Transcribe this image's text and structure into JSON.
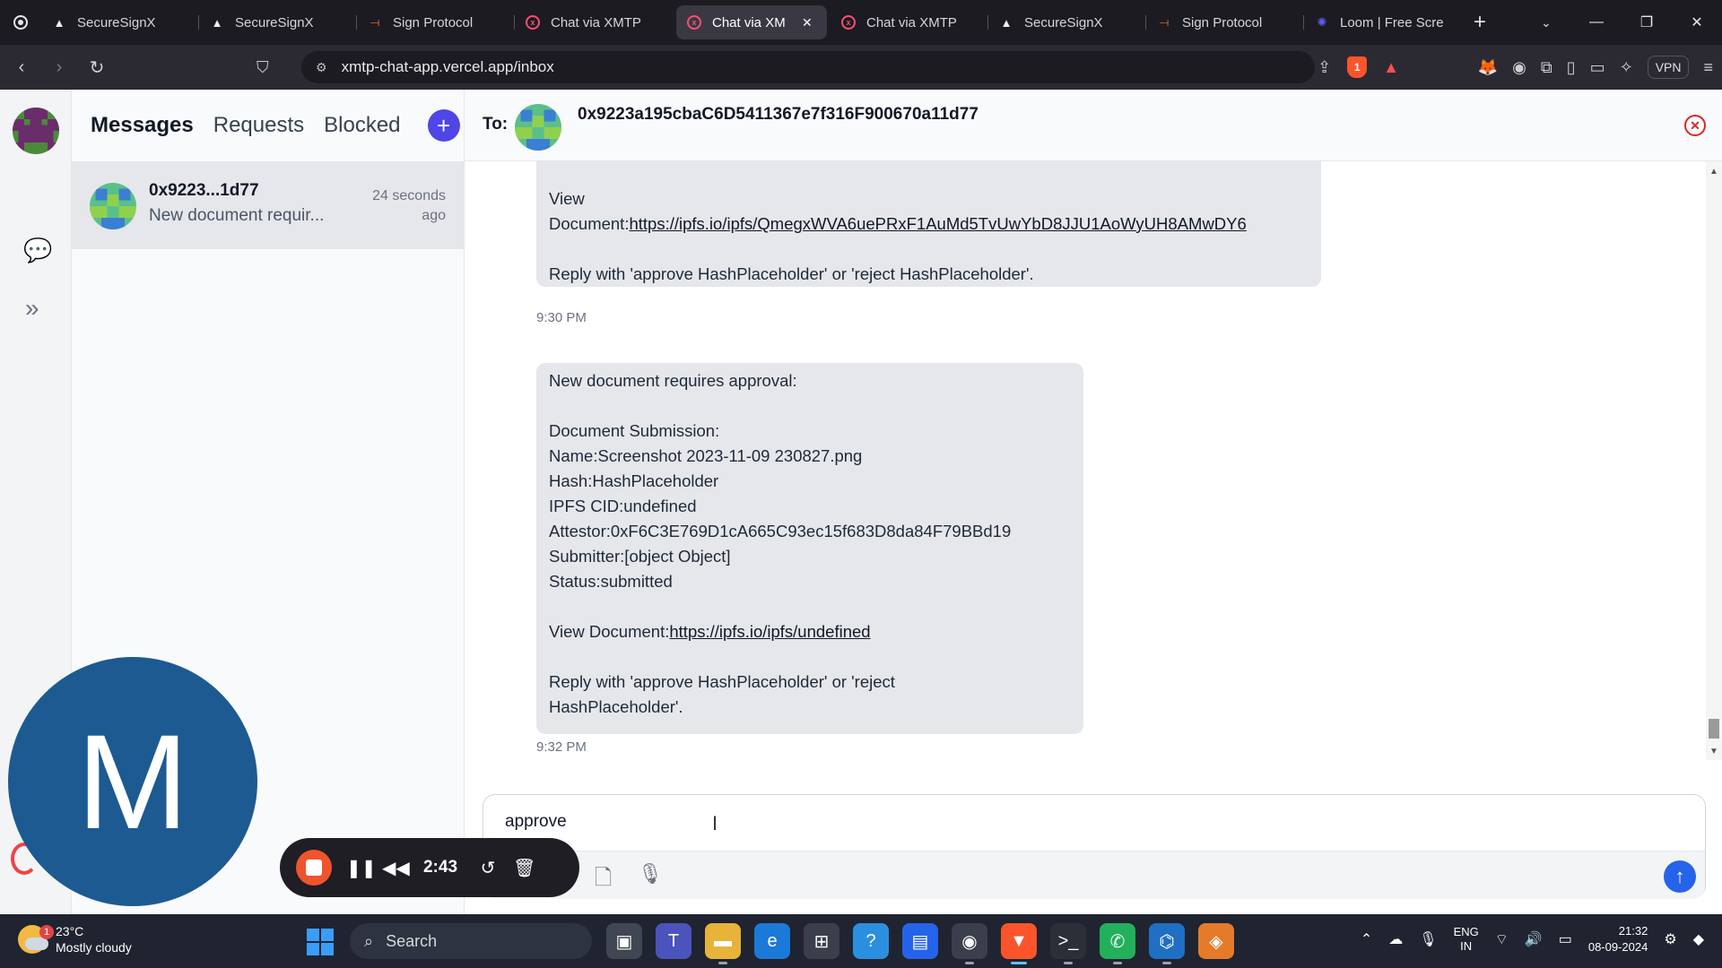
{
  "browser": {
    "tabs": [
      {
        "label": "SecureSignX",
        "icon": "triangle-icon"
      },
      {
        "label": "SecureSignX",
        "icon": "triangle-icon"
      },
      {
        "label": "Sign Protocol",
        "icon": "sign-protocol-icon"
      },
      {
        "label": "Chat via XMTP",
        "icon": "xmtp-icon"
      },
      {
        "label": "Chat via XM",
        "icon": "xmtp-icon",
        "active": true
      },
      {
        "label": "Chat via XMTP",
        "icon": "xmtp-icon"
      },
      {
        "label": "SecureSignX",
        "icon": "triangle-icon"
      },
      {
        "label": "Sign Protocol",
        "icon": "sign-protocol-icon"
      },
      {
        "label": "Loom | Free Scre",
        "icon": "loom-icon"
      }
    ],
    "url": "xmtp-chat-app.vercel.app/inbox",
    "vpn_label": "VPN",
    "brave_badge": "1"
  },
  "sidebar": {
    "tabs": [
      "Messages",
      "Requests",
      "Blocked"
    ],
    "selected_tab": "Messages"
  },
  "conversation": {
    "name": "0x9223...1d77",
    "preview": "New document requir...",
    "time": "24 seconds ago"
  },
  "chat": {
    "to_label": "To:",
    "address": "0x9223a195cbaC6D5411367e7f316F900670a11d77",
    "messages": [
      {
        "lines_top": [
          "View",
          "Document:"
        ],
        "link": "https://ipfs.io/ipfs/QmegxWVA6uePRxF1AuMd5TvUwYbD8JJU1AoWyUH8AMwDY6",
        "reply": "Reply with 'approve HashPlaceholder' or 'reject HashPlaceholder'.",
        "time": "9:30 PM"
      },
      {
        "intro": "New document requires approval:",
        "heading": "Document Submission:",
        "name": "Name:Screenshot 2023-11-09 230827.png",
        "hash": "Hash:HashPlaceholder",
        "cid": "IPFS CID:undefined",
        "attestor": "Attestor:0xF6C3E769D1cA665C93ec15f683D8da84F79BBd19",
        "submitter": "Submitter:[object Object]",
        "status": "Status:submitted",
        "view_label": "View Document:",
        "link": "https://ipfs.io/ipfs/undefined",
        "reply_line1": "Reply with 'approve HashPlaceholder' or 'reject",
        "reply_line2": "HashPlaceholder'.",
        "time": "9:32 PM"
      }
    ],
    "composer_value": "approve "
  },
  "loom": {
    "avatar_letter": "M",
    "timer": "2:43"
  },
  "taskbar": {
    "weather_temp": "23°C",
    "weather_desc": "Mostly cloudy",
    "weather_badge": "1",
    "search_label": "Search",
    "lang_line1": "ENG",
    "lang_line2": "IN",
    "time": "21:32",
    "date": "08-09-2024"
  },
  "colors": {
    "accent": "#4f46e5",
    "send_button": "#2563eb",
    "loom_stop": "#f0542d",
    "loom_avatar": "#1d5a91",
    "close_red": "#dc2626"
  }
}
